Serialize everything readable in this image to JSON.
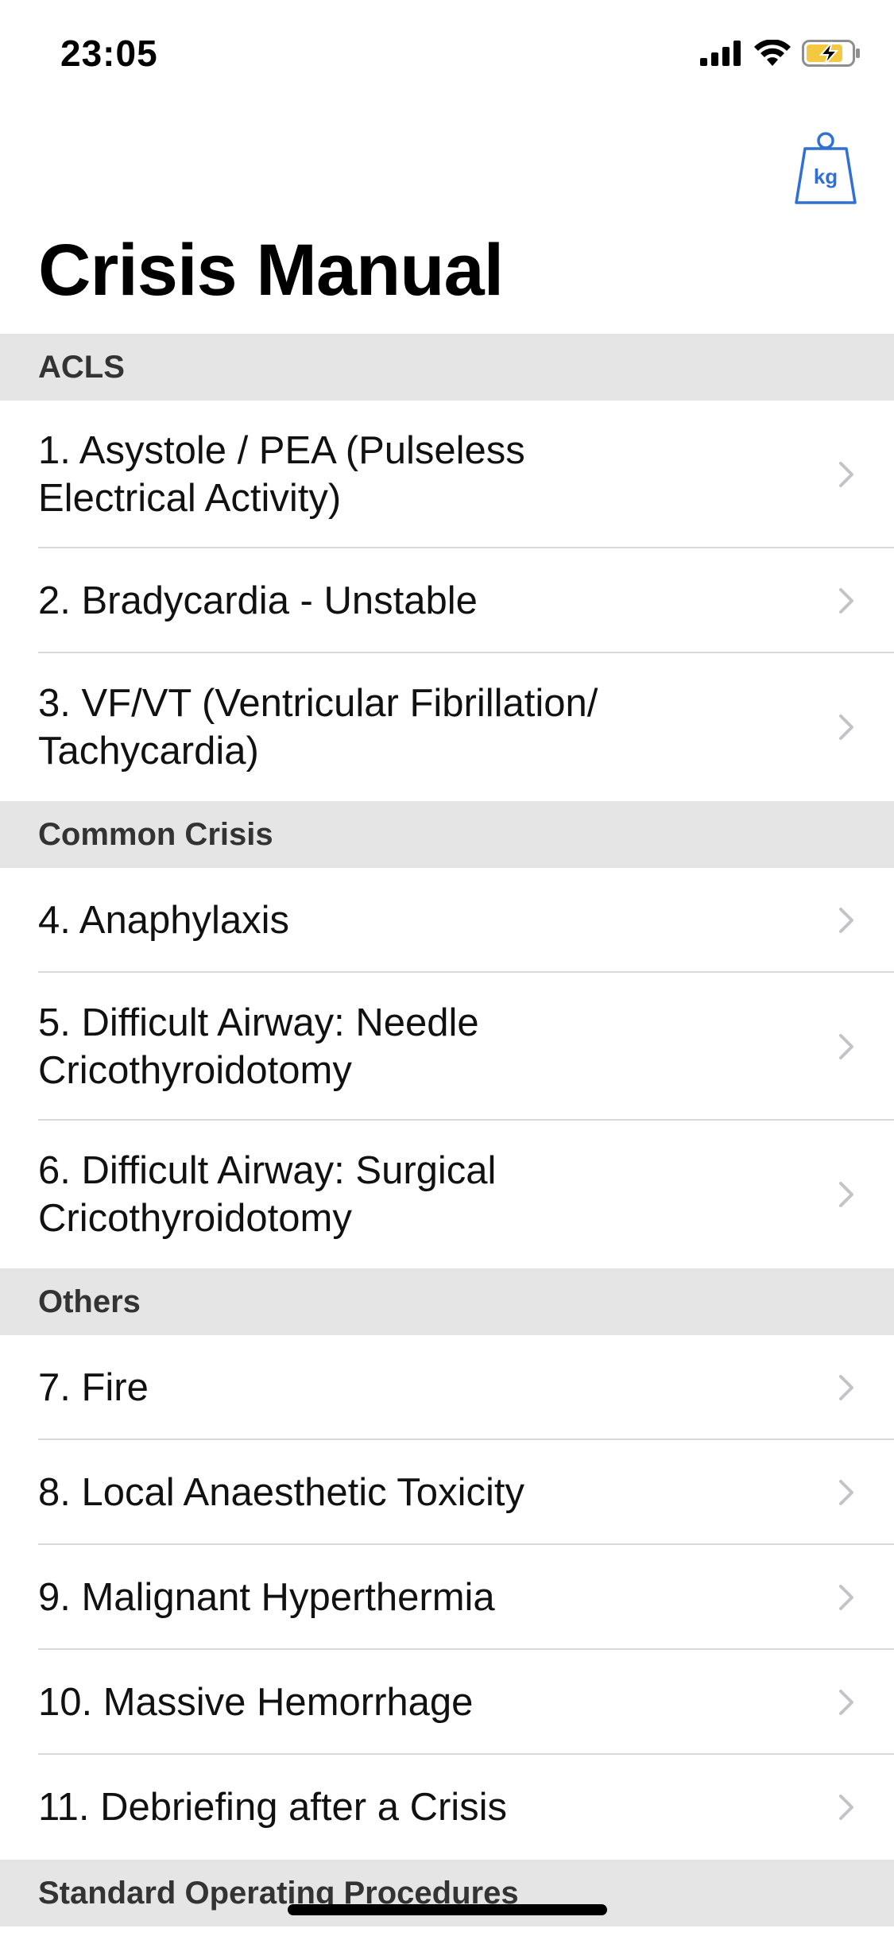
{
  "status_bar": {
    "time": "23:05"
  },
  "nav": {
    "weight_button_text": "kg",
    "accent_color": "#2f6fd6"
  },
  "page": {
    "title": "Crisis Manual"
  },
  "sections": [
    {
      "header": "ACLS",
      "items": [
        {
          "line1": "1. Asystole / PEA (Pulseless",
          "line2": "Electrical Activity)"
        },
        {
          "line1": "2. Bradycardia - Unstable",
          "line2": ""
        },
        {
          "line1": "3. VF/VT (Ventricular Fibrillation/",
          "line2": "Tachycardia)"
        }
      ]
    },
    {
      "header": "Common Crisis",
      "items": [
        {
          "line1": "4. Anaphylaxis",
          "line2": ""
        },
        {
          "line1": "5. Difficult Airway: Needle",
          "line2": "Cricothyroidotomy"
        },
        {
          "line1": "6. Difficult Airway: Surgical",
          "line2": "Cricothyroidotomy"
        }
      ]
    },
    {
      "header": "Others",
      "items": [
        {
          "line1": "7. Fire",
          "line2": ""
        },
        {
          "line1": "8. Local Anaesthetic Toxicity",
          "line2": ""
        },
        {
          "line1": "9. Malignant Hyperthermia",
          "line2": ""
        },
        {
          "line1": "10. Massive Hemorrhage",
          "line2": ""
        },
        {
          "line1": "11. Debriefing after a Crisis",
          "line2": ""
        }
      ]
    },
    {
      "header": "Standard Operating Procedures",
      "items": []
    }
  ]
}
